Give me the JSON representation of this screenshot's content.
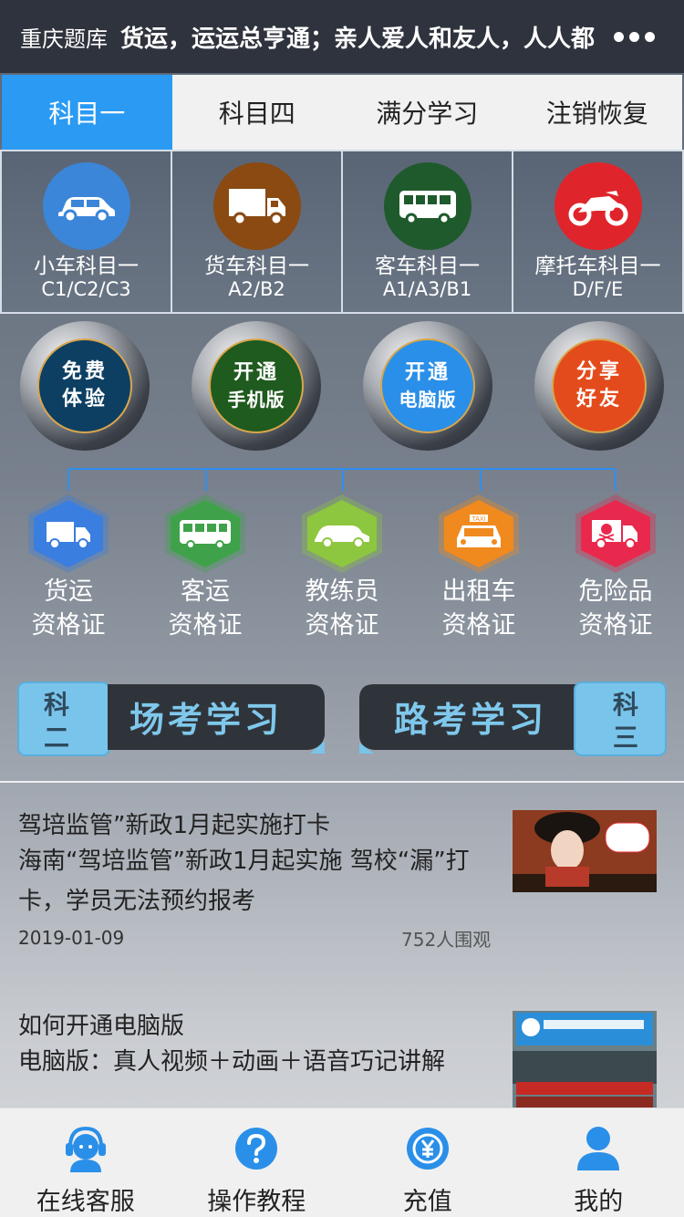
{
  "topbar": {
    "title": "重庆题库",
    "marquee": "货运，运运总亨通；亲人爱人和友人，人人都"
  },
  "tabs": [
    {
      "label": "科目一",
      "active": true
    },
    {
      "label": "科目四",
      "active": false
    },
    {
      "label": "满分学习",
      "active": false
    },
    {
      "label": "注销恢复",
      "active": false
    }
  ],
  "vehicles": [
    {
      "name": "小车科目一",
      "code": "C1/C2/C3",
      "color": "#3b86d8",
      "icon": "car-icon"
    },
    {
      "name": "货车科目一",
      "code": "A2/B2",
      "color": "#8a4a12",
      "icon": "truck-icon"
    },
    {
      "name": "客车科目一",
      "code": "A1/A3/B1",
      "color": "#1f5a2c",
      "icon": "bus-icon"
    },
    {
      "name": "摩托车科目一",
      "code": "D/F/E",
      "color": "#e0242b",
      "icon": "motorcycle-icon"
    }
  ],
  "buttons": [
    {
      "line1": "免费",
      "line2": "体验",
      "color": "#0d3f63"
    },
    {
      "line1": "开通",
      "line2": "手机版",
      "color": "#1f5a1f"
    },
    {
      "line1": "开通",
      "line2": "电脑版",
      "color": "#2a8fe8"
    },
    {
      "line1": "分享",
      "line2": "好友",
      "color": "#e44b1c"
    }
  ],
  "certs": [
    {
      "line1": "货运",
      "line2": "资格证",
      "color": "#3a7ee0",
      "icon": "freight-truck-icon"
    },
    {
      "line1": "客运",
      "line2": "资格证",
      "color": "#3fa24a",
      "icon": "passenger-bus-icon"
    },
    {
      "line1": "教练员",
      "line2": "资格证",
      "color": "#8dc63f",
      "icon": "coach-car-icon"
    },
    {
      "line1": "出租车",
      "line2": "资格证",
      "color": "#f08a1e",
      "icon": "taxi-icon"
    },
    {
      "line1": "危险品",
      "line2": "资格证",
      "color": "#e8294d",
      "icon": "hazard-truck-icon"
    }
  ],
  "taxi_sign": "TAXI",
  "banners": {
    "left": {
      "tag1": "科",
      "tag2": "二",
      "label": "场考学习"
    },
    "right": {
      "tag1": "科",
      "tag2": "三",
      "label": "路考学习"
    }
  },
  "news": [
    {
      "title": "驾培监管”新政1月起实施打卡",
      "body": "海南“驾培监管”新政1月起实施 驾校“漏”打卡，学员无法预约报考",
      "date": "2019-01-09",
      "views": "752人围观"
    },
    {
      "title": "如何开通电脑版",
      "body": "电脑版：真人视频＋动画＋语音巧记讲解"
    }
  ],
  "bottom_nav": [
    {
      "label": "在线客服",
      "icon": "customer-service-icon"
    },
    {
      "label": "操作教程",
      "icon": "question-icon"
    },
    {
      "label": "充值",
      "icon": "yuan-refresh-icon"
    },
    {
      "label": "我的",
      "icon": "user-icon"
    }
  ]
}
